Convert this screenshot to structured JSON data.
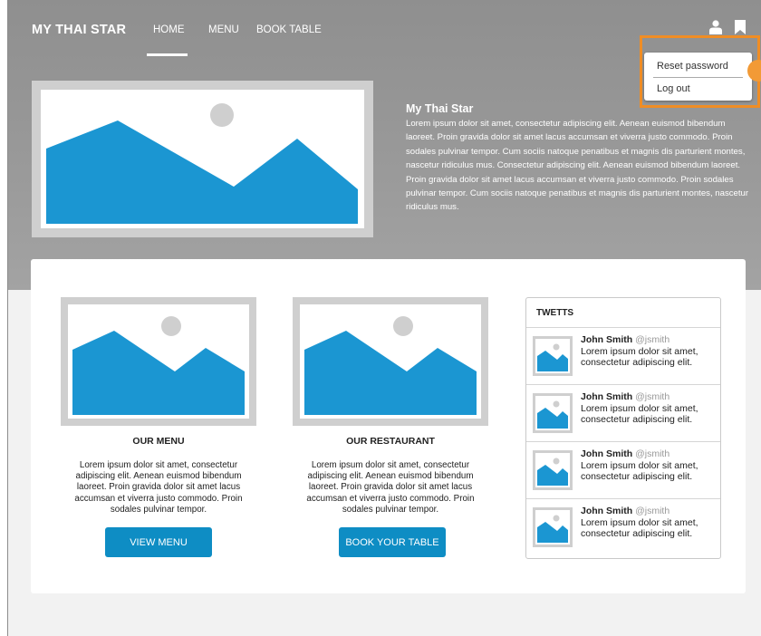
{
  "header": {
    "brand": "MY THAI STAR",
    "nav": [
      "HOME",
      "MENU",
      "BOOK TABLE"
    ],
    "active_nav": "HOME",
    "icons": [
      "user-icon",
      "bookmark-icon"
    ]
  },
  "user_menu": {
    "items": [
      "Reset password",
      "Log out"
    ]
  },
  "hero": {
    "title": "My Thai Star",
    "text": "Lorem ipsum dolor sit amet, consectetur adipiscing elit. Aenean euismod bibendum laoreet. Proin gravida dolor sit amet lacus accumsan et viverra justo commodo. Proin sodales pulvinar tempor. Cum sociis natoque penatibus et magnis dis parturient montes, nascetur ridiculus mus. Consectetur adipiscing elit. Aenean euismod bibendum laoreet. Proin gravida dolor sit amet lacus accumsan et viverra justo commodo. Proin sodales pulvinar tempor. Cum sociis natoque penatibus et magnis dis parturient montes, nascetur ridiculus mus."
  },
  "features": [
    {
      "title": "OUR MENU",
      "text": "Lorem ipsum dolor sit amet, consectetur adipiscing elit. Aenean euismod bibendum laoreet. Proin gravida dolor sit amet lacus accumsan et viverra justo commodo. Proin sodales pulvinar tempor.",
      "button": "VIEW MENU"
    },
    {
      "title": "OUR RESTAURANT",
      "text": "Lorem ipsum dolor sit amet, consectetur adipiscing elit. Aenean euismod bibendum laoreet. Proin gravida dolor sit amet lacus accumsan et viverra justo commodo. Proin sodales pulvinar tempor.",
      "button": "BOOK YOUR TABLE"
    }
  ],
  "tweets": {
    "title": "TWETTS",
    "items": [
      {
        "name": "John Smith",
        "handle": "@jsmith",
        "text": "Lorem ipsum dolor sit amet, consectetur adipiscing elit."
      },
      {
        "name": "John Smith",
        "handle": "@jsmith",
        "text": "Lorem ipsum dolor sit amet, consectetur adipiscing elit."
      },
      {
        "name": "John Smith",
        "handle": "@jsmith",
        "text": "Lorem ipsum dolor sit amet, consectetur adipiscing elit."
      },
      {
        "name": "John Smith",
        "handle": "@jsmith",
        "text": "Lorem ipsum dolor sit amet, consectetur adipiscing elit."
      }
    ]
  },
  "colors": {
    "accent": "#0e8dc4",
    "image_blue": "#1b96d2",
    "highlight": "#f08d24",
    "header_gray": "#939393"
  }
}
